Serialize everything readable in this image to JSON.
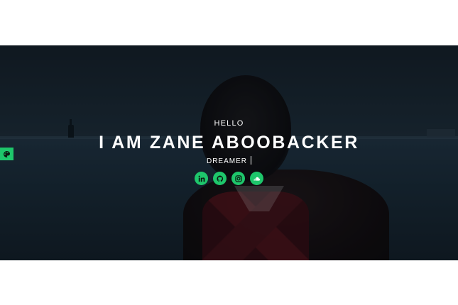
{
  "hero": {
    "greeting": "HELLO",
    "name": "I AM ZANE ABOOBACKER",
    "role": "DREAMER"
  },
  "social_links": [
    {
      "icon": "linkedin-icon",
      "glyph": "in"
    },
    {
      "icon": "github-icon"
    },
    {
      "icon": "instagram-icon"
    },
    {
      "icon": "soundcloud-icon"
    }
  ],
  "side_tab": {
    "icon": "palette-icon"
  },
  "colors": {
    "accent": "#1ec66b",
    "hero_text": "#ffffff",
    "page_background": "#ffffff"
  }
}
